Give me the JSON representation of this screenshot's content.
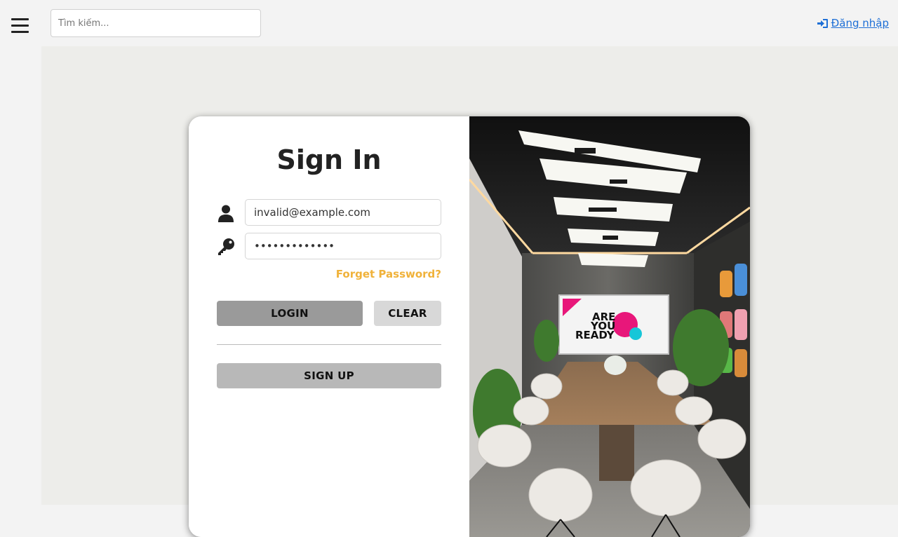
{
  "header": {
    "search_placeholder": "Tìm kiếm...",
    "login_link_label": "Đăng nhập"
  },
  "form": {
    "title": "Sign In",
    "email_value": "invalid@example.com",
    "password_value": "invalid123456",
    "forget_password_label": "Forget Password?",
    "login_button_label": "LOGIN",
    "clear_button_label": "CLEAR",
    "signup_button_label": "SIGN UP"
  },
  "image": {
    "poster_line1": "ARE",
    "poster_line2": "YOU",
    "poster_line3": "READY"
  },
  "colors": {
    "link": "#1e6fd6",
    "forget_password": "#f0b23a",
    "login_button": "#9a9a9a",
    "clear_button": "#d8d8d8",
    "signup_button": "#b8b8b8",
    "content_bg": "#ededea"
  },
  "icons": {
    "menu": "hamburger-icon",
    "login": "sign-in-icon",
    "email": "user-icon",
    "password": "key-icon"
  }
}
